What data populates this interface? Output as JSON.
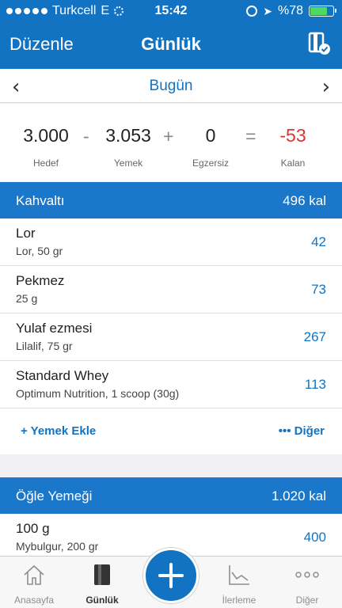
{
  "status": {
    "carrier": "Turkcell",
    "network": "E",
    "time": "15:42",
    "battery_label": "%78",
    "battery_level": 0.78
  },
  "nav": {
    "edit_label": "Düzenle",
    "title": "Günlük"
  },
  "date": {
    "label": "Bugün"
  },
  "summary": {
    "goal": {
      "value": "3.000",
      "label": "Hedef"
    },
    "op1": "-",
    "food": {
      "value": "3.053",
      "label": "Yemek"
    },
    "op2": "+",
    "exercise": {
      "value": "0",
      "label": "Egzersiz"
    },
    "op3": "=",
    "remaining": {
      "value": "-53",
      "label": "Kalan"
    }
  },
  "meals": [
    {
      "name": "Kahvaltı",
      "calories": "496 kal",
      "items": [
        {
          "name": "Lor",
          "detail": "Lor, 50 gr",
          "calories": "42"
        },
        {
          "name": "Pekmez",
          "detail": "25 g",
          "calories": "73"
        },
        {
          "name": "Yulaf ezmesi",
          "detail": "Lilalif, 75 gr",
          "calories": "267"
        },
        {
          "name": "Standard Whey",
          "detail": "Optimum Nutrition, 1 scoop (30g)",
          "calories": "113"
        }
      ],
      "add_label": "+ Yemek Ekle",
      "more_label": "••• Diğer"
    },
    {
      "name": "Öğle Yemeği",
      "calories": "1.020 kal",
      "items": [
        {
          "name": "100 g",
          "detail": "Mybulgur, 200 gr",
          "calories": "400"
        }
      ]
    }
  ],
  "tabs": [
    {
      "label": "Anasayfa",
      "icon": "home-icon"
    },
    {
      "label": "Günlük",
      "icon": "diary-icon"
    },
    {
      "label": "",
      "icon": "plus-icon"
    },
    {
      "label": "İlerleme",
      "icon": "chart-icon"
    },
    {
      "label": "Diğer",
      "icon": "more-icon"
    }
  ],
  "colors": {
    "primary": "#1273c2",
    "section": "#1a77c9",
    "negative": "#e0312f",
    "battery": "#4cd964"
  }
}
